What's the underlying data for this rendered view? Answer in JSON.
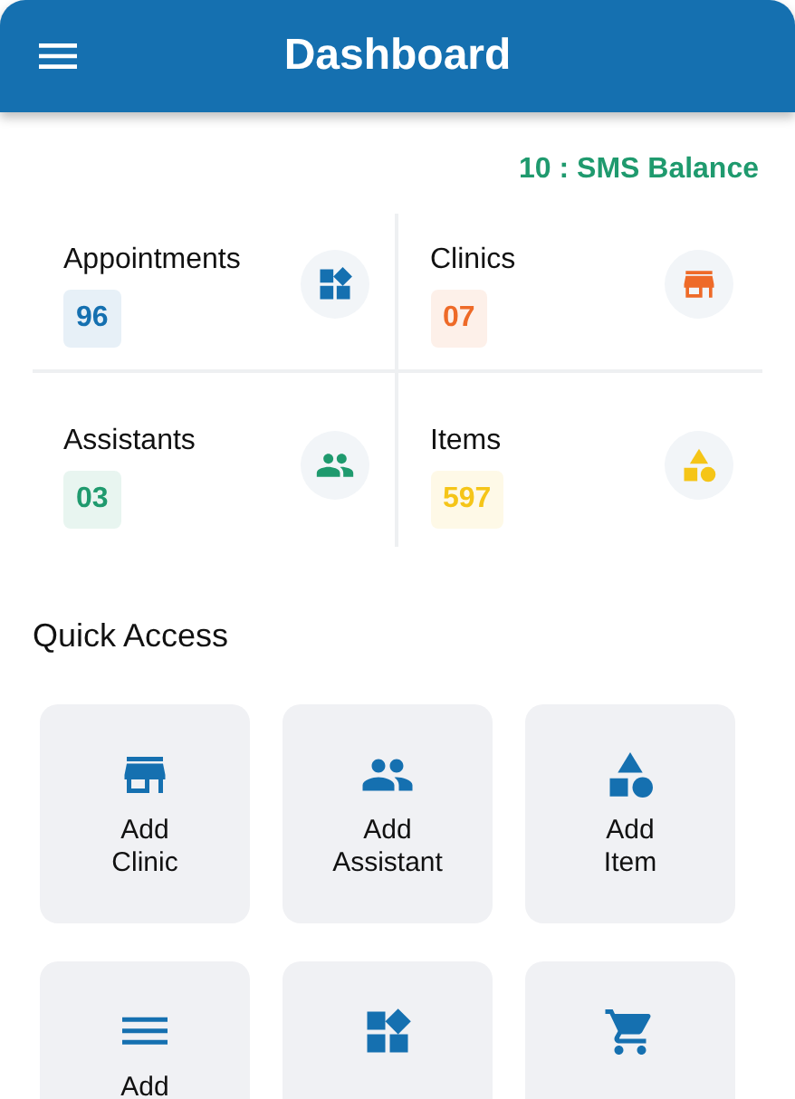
{
  "header": {
    "title": "Dashboard"
  },
  "sms_balance": "10 : SMS Balance",
  "stats": [
    {
      "label": "Appointments",
      "value": "96",
      "color": "#1570b0"
    },
    {
      "label": "Clinics",
      "value": "07",
      "color": "#ee6a28"
    },
    {
      "label": "Assistants",
      "value": "03",
      "color": "#1f9a6e"
    },
    {
      "label": "Items",
      "value": "597",
      "color": "#f5c518"
    }
  ],
  "quick_access": {
    "title": "Quick Access",
    "tiles": [
      {
        "kind": "labeled",
        "line1": "Add",
        "line2": "Clinic"
      },
      {
        "kind": "labeled",
        "line1": "Add",
        "line2": "Assistant"
      },
      {
        "kind": "labeled",
        "line1": "Add",
        "line2": "Item"
      },
      {
        "kind": "labeled",
        "line1": "Add"
      },
      {
        "kind": "icon_only"
      },
      {
        "kind": "icon_only"
      }
    ]
  }
}
